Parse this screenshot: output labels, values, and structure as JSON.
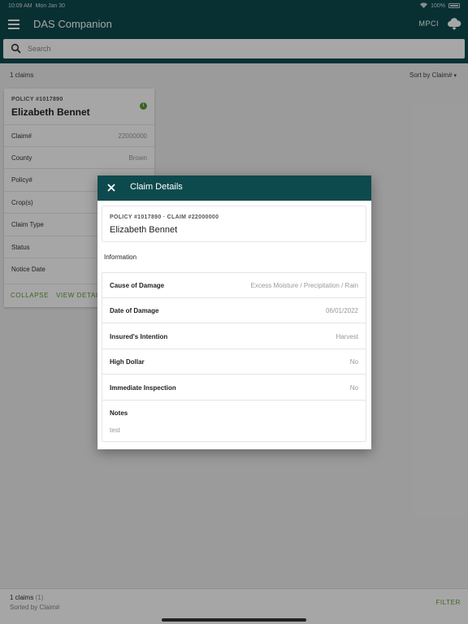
{
  "status_bar": {
    "time": "10:09 AM",
    "date": "Mon Jan 30",
    "battery": "100%"
  },
  "app": {
    "title": "DAS Companion",
    "program": "MPCI"
  },
  "search": {
    "placeholder": "Search"
  },
  "list": {
    "count": "1 claims",
    "sort": "Sort by Claim#"
  },
  "card": {
    "policy": "POLICY #1017890",
    "name": "Elizabeth Bennet",
    "rows": [
      {
        "label": "Claim#",
        "value": "22000000"
      },
      {
        "label": "County",
        "value": "Brown"
      },
      {
        "label": "Policy#",
        "value": ""
      },
      {
        "label": "Crop(s)",
        "value": ""
      },
      {
        "label": "Claim Type",
        "value": ""
      },
      {
        "label": "Status",
        "value": ""
      },
      {
        "label": "Notice Date",
        "value": ""
      }
    ],
    "collapse": "COLLAPSE",
    "view_details": "VIEW DETAILS"
  },
  "footer": {
    "count": "1 claims",
    "count_extra": "(1)",
    "sorted": "Sorted by Claim#",
    "filter": "FILTER"
  },
  "modal": {
    "title": "Claim Details",
    "subtitle": "POLICY #1017890 · CLAIM #22000000",
    "name": "Elizabeth Bennet",
    "section": "Information",
    "rows": [
      {
        "label": "Cause of Damage",
        "value": "Excess Moisture / Precipitation / Rain"
      },
      {
        "label": "Date of Damage",
        "value": "06/01/2022"
      },
      {
        "label": "Insured's Intention",
        "value": "Harvest"
      },
      {
        "label": "High Dollar",
        "value": "No"
      },
      {
        "label": "Immediate Inspection",
        "value": "No"
      }
    ],
    "notes_label": "Notes",
    "notes_value": "test"
  },
  "colors": {
    "header": "#0d4a4e",
    "accent": "#5c9c38"
  }
}
